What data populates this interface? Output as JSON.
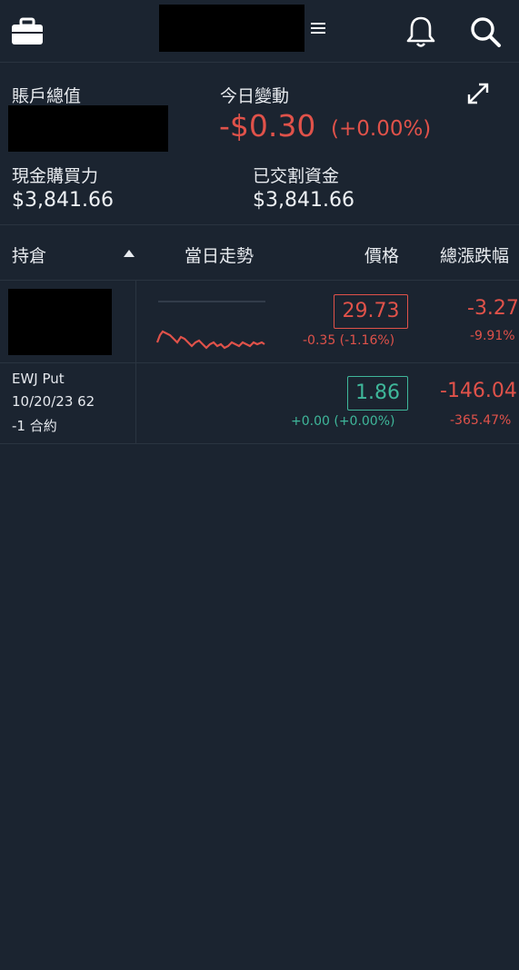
{
  "header": {
    "menu_glyph": "≡"
  },
  "summary": {
    "account_value_label": "賬戶總值",
    "day_change_label": "今日變動",
    "day_change_value": "-$0.30",
    "day_change_pct": "(+0.00%)",
    "buying_power_label": "現金購買力",
    "buying_power_value": "$3,841.66",
    "settled_cash_label": "已交割資金",
    "settled_cash_value": "$3,841.66"
  },
  "table": {
    "headers": {
      "position": "持倉",
      "intraday": "當日走勢",
      "price": "價格",
      "total_change": "總漲跌幅"
    },
    "rows": [
      {
        "symbol": "",
        "price": "29.73",
        "change": "-0.35 (-1.16%)",
        "total_change": "-3.27",
        "total_change_pct": "-9.91%"
      },
      {
        "symbol_line1": "EWJ Put",
        "symbol_line2": "10/20/23 62",
        "symbol_line3": "-1 合約",
        "price": "1.86",
        "change": "+0.00 (+0.00%)",
        "total_change": "-146.04",
        "total_change_pct": "-365.47%"
      }
    ]
  },
  "colors": {
    "background": "#1b2430",
    "negative": "#e0524a",
    "positive": "#3fb79a"
  },
  "icons": [
    "briefcase-icon",
    "menu-icon",
    "bell-icon",
    "search-icon",
    "expand-icon"
  ]
}
